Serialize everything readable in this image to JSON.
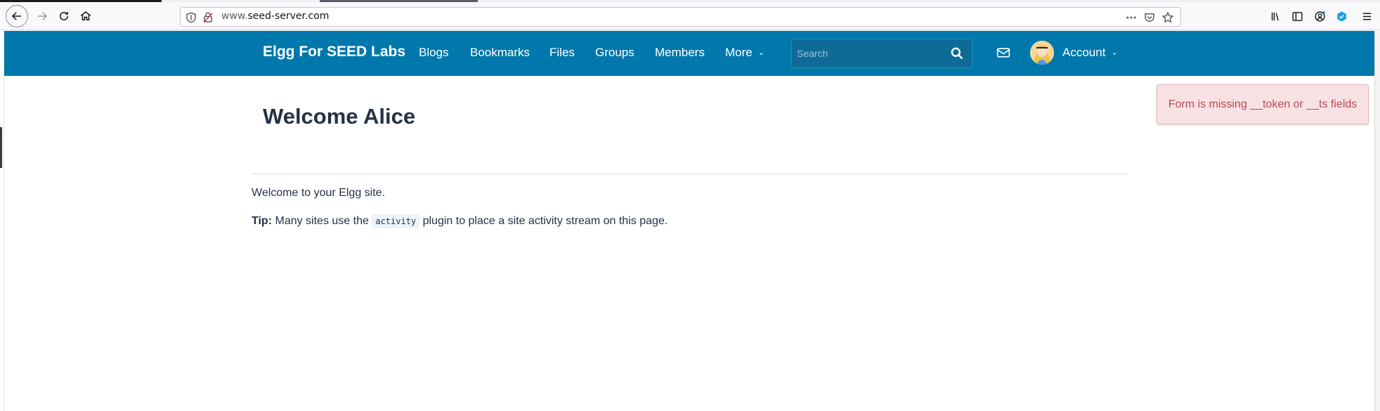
{
  "browser": {
    "url_host_prefix": "www.",
    "url_host": "seed-server.com"
  },
  "site": {
    "brand": "Elgg For SEED Labs",
    "nav": [
      "Blogs",
      "Bookmarks",
      "Files",
      "Groups",
      "Members",
      "More"
    ],
    "search_placeholder": "Search",
    "account_label": "Account"
  },
  "main": {
    "title": "Welcome Alice",
    "intro": "Welcome to your Elgg site.",
    "tip_label": "Tip:",
    "tip_before": "Many sites use the",
    "tip_code": "activity",
    "tip_after": "plugin to place a site activity stream on this page."
  },
  "toast": {
    "message": "Form is missing __token or __ts fields"
  },
  "colors": {
    "topbar": "#0078ac",
    "title": "#263145",
    "toast_bg": "#f8e1e2",
    "toast_text": "#b44a52"
  }
}
